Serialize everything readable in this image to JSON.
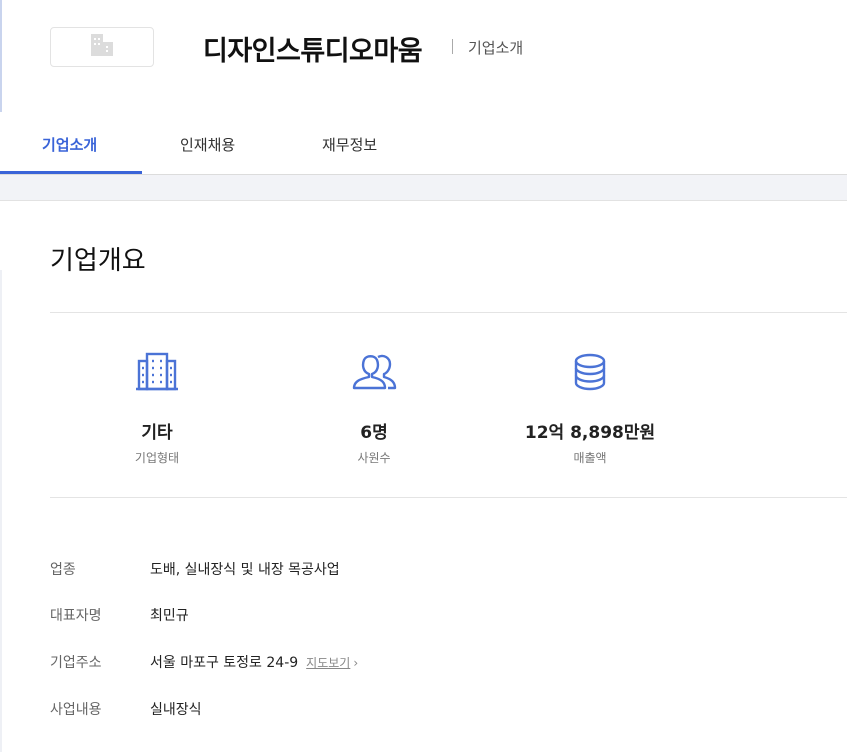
{
  "header": {
    "logo_icon": "building-icon",
    "company_name": "디자인스튜디오마움",
    "subtitle": "기업소개"
  },
  "tabs": [
    {
      "label": "기업소개",
      "active": true
    },
    {
      "label": "인재채용",
      "active": false
    },
    {
      "label": "재무정보",
      "active": false
    }
  ],
  "overview": {
    "title": "기업개요",
    "stats": [
      {
        "icon": "building-icon",
        "value": "기타",
        "label": "기업형태"
      },
      {
        "icon": "people-icon",
        "value": "6명",
        "label": "사원수"
      },
      {
        "icon": "coins-stack-icon",
        "value": "12억 8,898만원",
        "label": "매출액"
      }
    ],
    "details": [
      {
        "key": "업종",
        "value": "도배, 실내장식 및 내장 목공사업"
      },
      {
        "key": "대표자명",
        "value": "최민규"
      },
      {
        "key": "기업주소",
        "value": "서울 마포구 토정로 24-9",
        "link": "지도보기"
      },
      {
        "key": "사업내용",
        "value": "실내장식"
      }
    ]
  },
  "colors": {
    "accent": "#3a64d8",
    "icon": "#4b73d6"
  }
}
